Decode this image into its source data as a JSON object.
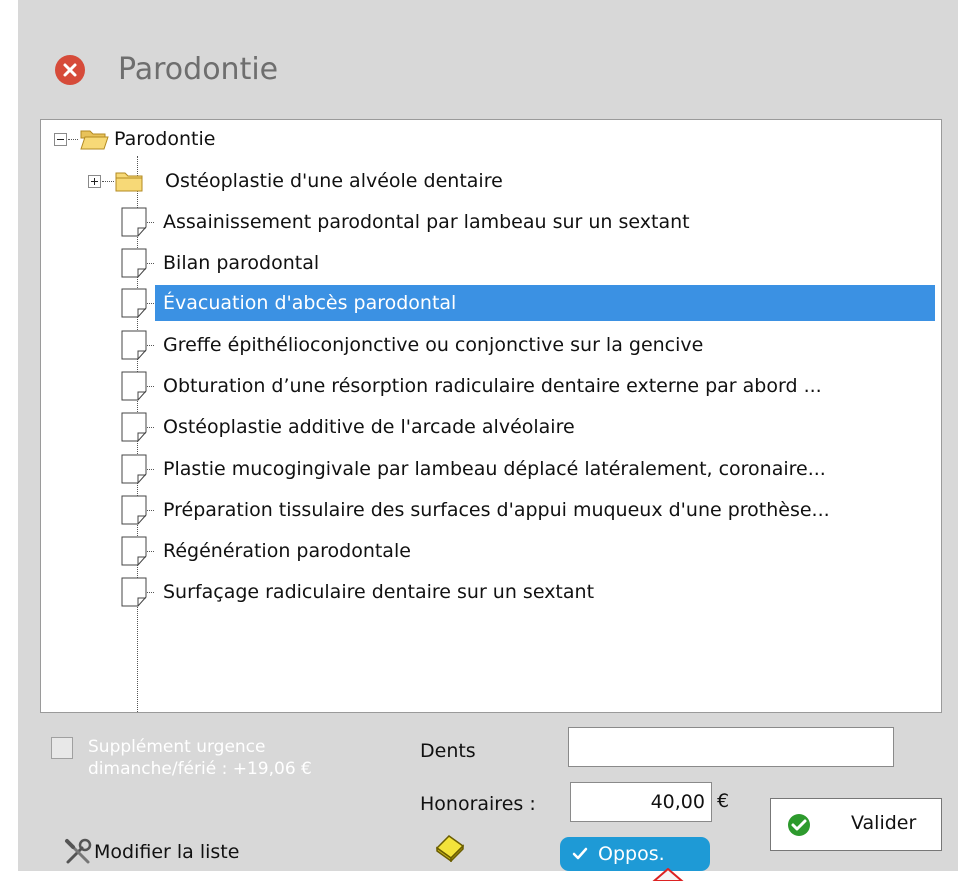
{
  "window": {
    "title": "Parodontie"
  },
  "tree": {
    "root": {
      "label": "Parodontie",
      "expanded": true
    },
    "items": [
      {
        "label": "Ostéoplastie d'une alvéole dentaire",
        "type": "folder",
        "expanded": false
      },
      {
        "label": "Assainissement parodontal par lambeau sur un sextant",
        "type": "document"
      },
      {
        "label": "Bilan parodontal",
        "type": "document"
      },
      {
        "label": "Évacuation d'abcès parodontal",
        "type": "document",
        "selected": true
      },
      {
        "label": "Greffe épithélioconjonctive ou conjonctive sur la gencive",
        "type": "document"
      },
      {
        "label": "Obturation d’une résorption radiculaire dentaire externe par abord ...",
        "type": "document"
      },
      {
        "label": "Ostéoplastie additive de l'arcade alvéolaire",
        "type": "document"
      },
      {
        "label": "Plastie mucogingivale par lambeau déplacé latéralement, coronaire...",
        "type": "document"
      },
      {
        "label": "Préparation tissulaire des surfaces d'appui muqueux d'une prothèse...",
        "type": "document"
      },
      {
        "label": "Régénération parodontale",
        "type": "document"
      },
      {
        "label": "Surfaçage radiculaire dentaire sur un sextant",
        "type": "document"
      }
    ]
  },
  "form": {
    "urgence_line1": "Supplément urgence",
    "urgence_line2": "dimanche/férié : +19,06 €",
    "urgence_checked": false,
    "dents_label": "Dents",
    "dents_value": "",
    "honoraires_label": "Honoraires :",
    "honoraires_value": "40,00",
    "currency": "€"
  },
  "actions": {
    "modifier_label": "Modifier la liste",
    "valider_label": "Valider",
    "oppos_label": "Oppos."
  },
  "colors": {
    "selection": "#3b91e3",
    "close": "#d64b3a",
    "valider_check": "#2d9a2d",
    "oppos_bg": "#1e9ad6"
  },
  "icons": {
    "close": "close-icon",
    "folder": "folder-icon",
    "document": "document-icon",
    "tools": "tools-icon",
    "eraser": "eraser-icon",
    "check": "check-icon"
  }
}
